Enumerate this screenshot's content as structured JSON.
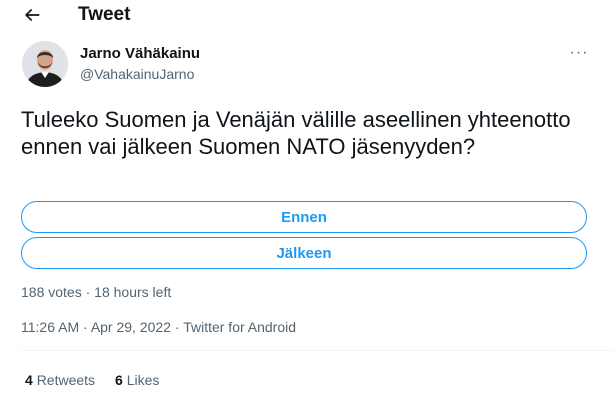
{
  "header": {
    "title": "Tweet",
    "back_icon": "arrow-left-icon"
  },
  "author": {
    "name": "Jarno Vähäkainu",
    "handle": "@VahakainuJarno",
    "more_icon": "more-horizontal-icon",
    "more_label": "···"
  },
  "tweet": {
    "text": "Tuleeko Suomen ja Venäjän välille aseellinen yhteenotto ennen vai jälkeen Suomen NATO jäsenyyden?"
  },
  "poll": {
    "options": [
      "Ennen",
      "Jälkeen"
    ],
    "votes_text": "188 votes",
    "separator": "·",
    "time_left": "18 hours left"
  },
  "meta": {
    "time": "11:26 AM",
    "date": "Apr 29, 2022",
    "source": "Twitter for Android",
    "separator": "·"
  },
  "stats": {
    "retweets_count": "4",
    "retweets_label": "Retweets",
    "likes_count": "6",
    "likes_label": "Likes"
  },
  "colors": {
    "accent": "#1d9bf0",
    "text": "#0f1419",
    "secondary": "#536471"
  }
}
